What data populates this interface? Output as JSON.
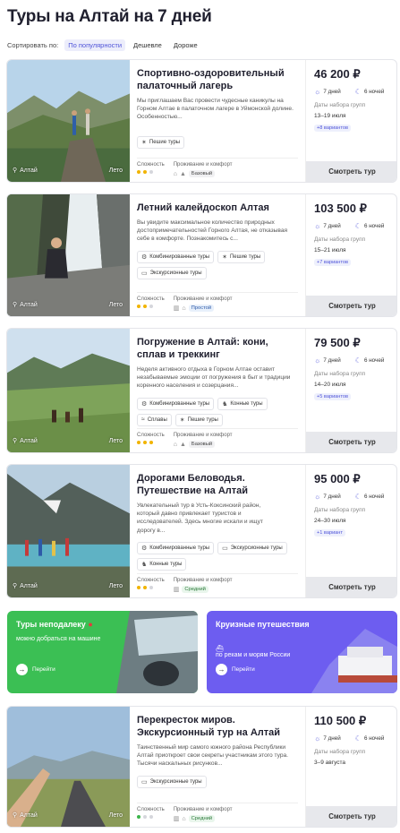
{
  "page": {
    "title": "Туры на Алтай на 7 дней"
  },
  "sort": {
    "label": "Сортировать по:",
    "options": [
      "По популярности",
      "Дешевле",
      "Дороже"
    ]
  },
  "common": {
    "view_button": "Смотреть тур",
    "dates_label": "Даты набора групп",
    "difficulty_label": "Сложность",
    "comfort_label": "Проживание и комфорт",
    "location": "Алтай",
    "season": "Лето"
  },
  "tours": [
    {
      "title": "Спортивно-оздоровительный палаточный лагерь",
      "description": "Мы приглашаем Вас провести чудесные каникулы на Горном Алтае в палаточном лагере в Уймонской долине. Особенностью...",
      "tags": [
        "Пешие туры"
      ],
      "price": "46 200 ₽",
      "days": "7 дней",
      "nights": "6 ночей",
      "dates": "13–19 июля",
      "variants": "+8 вариантов",
      "difficulty": 2,
      "comfort": "Базовый"
    },
    {
      "title": "Летний калейдоскоп Алтая",
      "description": "Вы увидите максимальное количество природных достопримечательностей Горного Алтая, не отказывая себе в комфорте. Познакомитесь с...",
      "tags": [
        "Комбинированные туры",
        "Пешие туры",
        "Экскурсионные туры"
      ],
      "price": "103 500 ₽",
      "days": "7 дней",
      "nights": "6 ночей",
      "dates": "15–21 июля",
      "variants": "+7 вариантов",
      "difficulty": 2,
      "comfort": "Простой"
    },
    {
      "title": "Погружение в Алтай: кони, сплав и треккинг",
      "description": "Неделя активного отдыха в Горном Алтае оставит незабываемые эмоции от погружения в быт и традиции коренного населения и созерцания...",
      "tags": [
        "Комбинированные туры",
        "Конные туры",
        "Сплавы",
        "Пешие туры"
      ],
      "price": "79 500 ₽",
      "days": "7 дней",
      "nights": "6 ночей",
      "dates": "14–20 июля",
      "variants": "+5 вариантов",
      "difficulty": 3,
      "comfort": "Базовый"
    },
    {
      "title": "Дорогами Беловодья. Путешествие на Алтай",
      "description": "Увлекательный тур в Усть-Коксинский район, который давно привлекает туристов и исследователей. Здесь многие искали и ищут дорогу в...",
      "tags": [
        "Комбинированные туры",
        "Экскурсионные туры",
        "Конные туры"
      ],
      "price": "95 000 ₽",
      "days": "7 дней",
      "nights": "6 ночей",
      "dates": "24–30 июля",
      "variants": "+1 вариант",
      "difficulty": 2,
      "comfort": "Средний"
    },
    {
      "title": "Перекресток миров. Экскурсионный тур на Алтай",
      "description": "Таинственный мир самого южного района Республики Алтай приоткроет свои секреты участникам этого тура. Тысячи наскальных рисунков...",
      "tags": [
        "Экскурсионные туры"
      ],
      "price": "110 500 ₽",
      "days": "7 дней",
      "nights": "6 ночей",
      "dates": "3–9 августа",
      "variants": "",
      "difficulty": 1,
      "comfort": "Средний"
    }
  ],
  "banners": [
    {
      "title": "Туры неподалеку",
      "subtitle": "можно добраться на машине",
      "button": "Перейти"
    },
    {
      "title": "Круизные путешествия",
      "subtitle": "по рекам и морям России",
      "button": "Перейти"
    }
  ],
  "colors": {
    "accent": "#4f54d9",
    "green_banner": "#3bbf54",
    "purple_banner": "#6d5df0"
  }
}
